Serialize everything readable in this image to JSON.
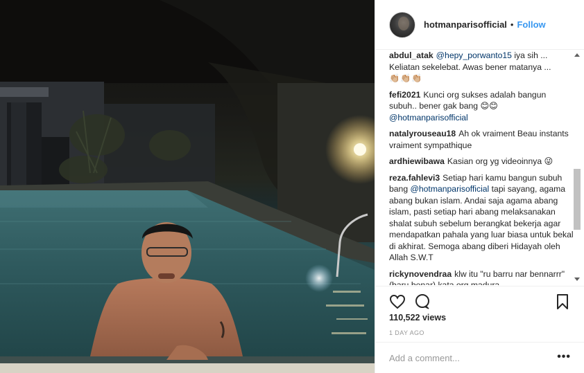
{
  "header": {
    "username": "hotmanparisofficial",
    "separator": "•",
    "follow_label": "Follow"
  },
  "comments": [
    {
      "user": "abdul_atak",
      "mention": "@hepy_porwanto15",
      "text": " iya sih ... Keliatan sekelebat. Awas bener matanya ...",
      "extra": "👏🏼👏🏼👏🏼"
    },
    {
      "user": "fefi2021",
      "text": "Kunci org sukses adalah bangun subuh.. bener gak bang 😊😊",
      "mention": "@hotmanparisofficial"
    },
    {
      "user": "natalyrouseau18",
      "text": "Ah ok vraiment Beau instants vraiment sympathique"
    },
    {
      "user": "ardhiewibawa",
      "text": "Kasian org yg videoinnya 😜"
    },
    {
      "user": "reza.fahlevi3",
      "text_before": "Setiap hari kamu bangun subuh bang ",
      "mention": "@hotmanparisofficial",
      "text_after": " tapi sayang, agama abang bukan islam. Andai saja agama abang islam, pasti setiap hari abang melaksanakan shalat subuh sebelum berangkat bekerja agar mendapatkan pahala yang luar biasa untuk bekal di akhirat. Semoga abang diberi Hidayah oleh Allah S.W.T"
    },
    {
      "user": "rickynovendraa",
      "text": "klw itu \"ru barru nar bennarrr\" (baru benar) kata org madura"
    }
  ],
  "actions": {
    "like_icon": "heart-icon",
    "comment_icon": "comment-icon",
    "save_icon": "bookmark-icon"
  },
  "views_label": "110,522 views",
  "date_label": "1 DAY AGO",
  "add_comment": {
    "placeholder": "Add a comment...",
    "more_label": "•••"
  },
  "colors": {
    "link": "#3897f0",
    "mention": "#003569",
    "border": "#efefef"
  }
}
